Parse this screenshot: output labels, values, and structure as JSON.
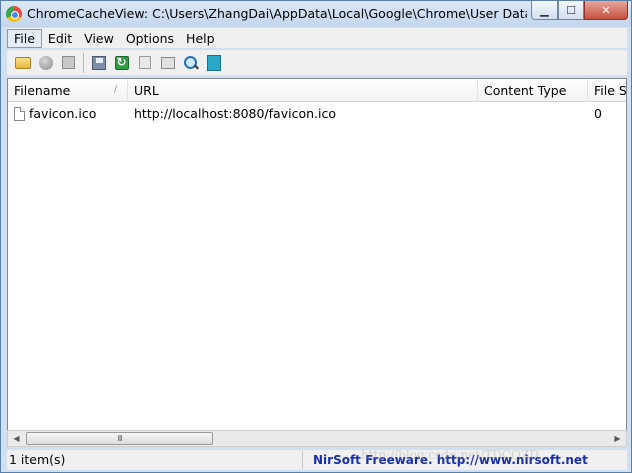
{
  "window": {
    "title": "ChromeCacheView:   C:\\Users\\ZhangDai\\AppData\\Local\\Google\\Chrome\\User Data\\..."
  },
  "menu": {
    "items": [
      "File",
      "Edit",
      "View",
      "Options",
      "Help"
    ],
    "active": "File"
  },
  "toolbar": {
    "icons": [
      "open-folder-icon",
      "stop-icon",
      "copy-icon",
      "save-icon",
      "refresh-icon",
      "copy-clipboard-icon",
      "properties-icon",
      "find-icon",
      "exit-icon"
    ]
  },
  "list": {
    "columns": [
      "Filename",
      "URL",
      "Content Type",
      "File Siz"
    ],
    "sort_indicator": "/",
    "rows": [
      {
        "filename": "favicon.ico",
        "url": "http://localhost:8080/favicon.ico",
        "content_type": "",
        "file_size": "0"
      }
    ]
  },
  "scrollbar": {
    "thumb_grip": "III"
  },
  "status": {
    "items_count": "1 item(s)",
    "credit": "NirSoft Freeware.  http://www.nirsoft.net",
    "watermark": "http://blog.csdn.net/TDCQZD"
  },
  "colors": {
    "credit_text": "#1a2fb0",
    "titlebar": "#c3d6ec",
    "close_button": "#c7503e"
  }
}
